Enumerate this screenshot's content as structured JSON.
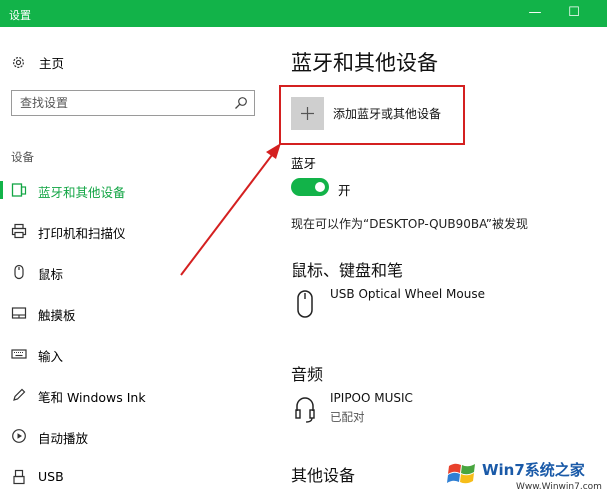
{
  "window": {
    "title": "设置",
    "minimize_glyph": "—",
    "maximize_glyph": "☐",
    "accent_color": "#12b349"
  },
  "sidebar": {
    "home_label": "主页",
    "home_icon": "gear-icon",
    "search_placeholder": "查找设置",
    "search_icon": "search-icon",
    "section_label": "设备",
    "items": [
      {
        "label": "蓝牙和其他设备",
        "icon": "bluetooth-devices-icon",
        "active": true
      },
      {
        "label": "打印机和扫描仪",
        "icon": "printer-icon",
        "active": false
      },
      {
        "label": "鼠标",
        "icon": "mouse-icon",
        "active": false
      },
      {
        "label": "触摸板",
        "icon": "touchpad-icon",
        "active": false
      },
      {
        "label": "输入",
        "icon": "keyboard-icon",
        "active": false
      },
      {
        "label": "笔和 Windows Ink",
        "icon": "pen-icon",
        "active": false
      },
      {
        "label": "自动播放",
        "icon": "autoplay-icon",
        "active": false
      },
      {
        "label": "USB",
        "icon": "usb-icon",
        "active": false
      }
    ]
  },
  "main": {
    "title": "蓝牙和其他设备",
    "add_device_label": "添加蓝牙或其他设备",
    "add_device_icon": "plus-icon",
    "bluetooth_label": "蓝牙",
    "bluetooth_state": "开",
    "bluetooth_on": true,
    "discoverable_text": "现在可以作为“DESKTOP-QUB90BA”被发现",
    "groups": {
      "mouse_keyboard_pen": {
        "title": "鼠标、键盘和笔",
        "devices": [
          {
            "name": "USB Optical Wheel Mouse",
            "icon": "mouse-icon"
          }
        ]
      },
      "audio": {
        "title": "音频",
        "devices": [
          {
            "name": "IPIPOO MUSIC",
            "status": "已配对",
            "icon": "headphones-icon"
          }
        ]
      },
      "other": {
        "title": "其他设备"
      }
    }
  },
  "annotation": {
    "highlight_color": "#d42020"
  },
  "watermark": {
    "brand": "Win7系统之家",
    "url": "Www.Winwin7.com"
  }
}
